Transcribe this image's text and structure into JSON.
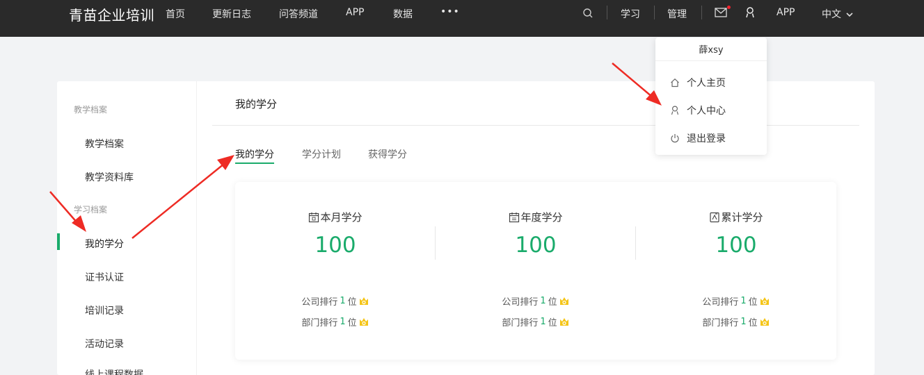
{
  "header": {
    "brand": "青苗企业培训",
    "nav": [
      "首页",
      "更新日志",
      "问答频道",
      "APP",
      "数据"
    ],
    "more": "•••",
    "right": {
      "study": "学习",
      "manage": "管理",
      "app": "APP",
      "language": "中文"
    }
  },
  "dropdown": {
    "username": "薛xsy",
    "items": [
      {
        "label": "个人主页",
        "icon": "home-icon"
      },
      {
        "label": "个人中心",
        "icon": "user-icon"
      },
      {
        "label": "退出登录",
        "icon": "power-icon"
      }
    ]
  },
  "sidebar": {
    "groups": [
      {
        "title": "教学档案",
        "items": [
          "教学档案",
          "教学资料库"
        ]
      },
      {
        "title": "学习档案",
        "items": [
          "我的学分",
          "证书认证",
          "培训记录",
          "活动记录",
          "线上课程数据"
        ]
      }
    ],
    "active": "我的学分"
  },
  "main": {
    "title": "我的学分",
    "tabs": [
      "我的学分",
      "学分计划",
      "获得学分"
    ],
    "active_tab": "我的学分"
  },
  "stats": [
    {
      "label": "本月学分",
      "value": "100",
      "icon": "calendar-month-icon",
      "company_rank_label": "公司排行",
      "company_rank": "1",
      "dept_rank_label": "部门排行",
      "dept_rank": "1",
      "unit": "位"
    },
    {
      "label": "年度学分",
      "value": "100",
      "icon": "calendar-year-icon",
      "company_rank_label": "公司排行",
      "company_rank": "1",
      "dept_rank_label": "部门排行",
      "dept_rank": "1",
      "unit": "位"
    },
    {
      "label": "累计学分",
      "value": "100",
      "icon": "cumulative-icon",
      "company_rank_label": "公司排行",
      "company_rank": "1",
      "dept_rank_label": "部门排行",
      "dept_rank": "1",
      "unit": "位"
    }
  ],
  "colors": {
    "accent": "#1aab6b",
    "topbar": "#2a2a2a",
    "arrow": "#ee2b24",
    "medal": "#f5c518"
  }
}
